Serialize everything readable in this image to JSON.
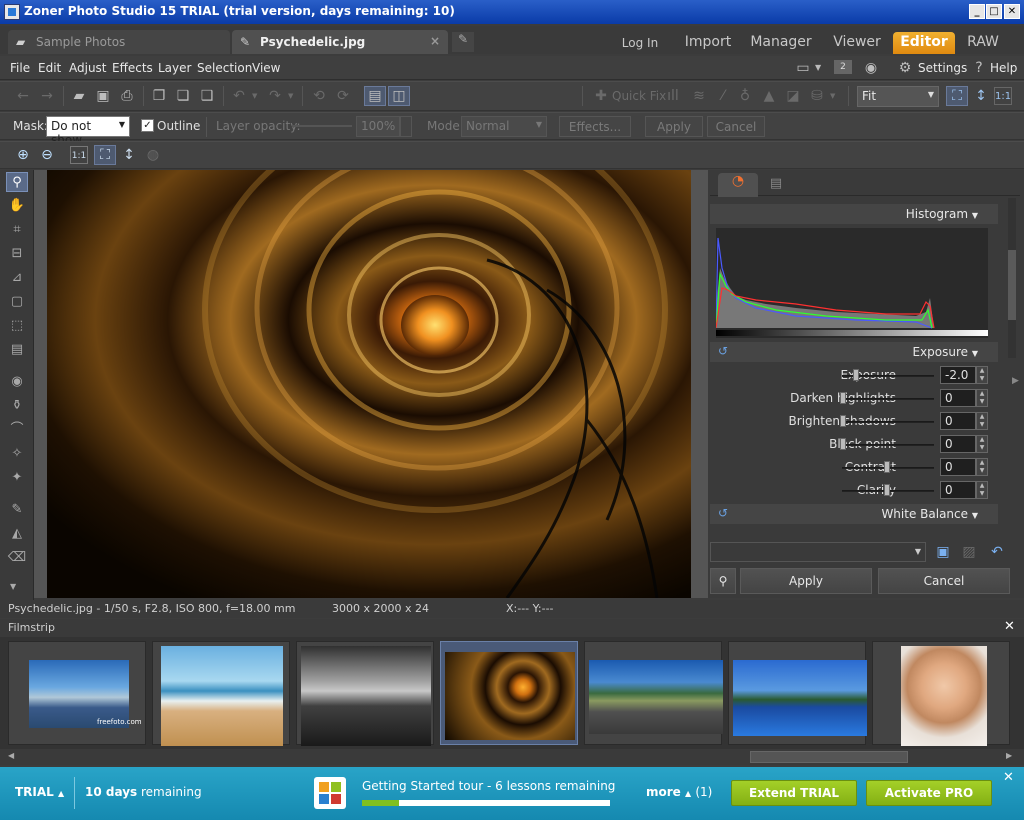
{
  "window": {
    "title": "Zoner Photo Studio 15 TRIAL (trial version, days remaining: 10)"
  },
  "tabs": {
    "doc_tabs": [
      {
        "label": "Sample Photos"
      },
      {
        "label": "Psychedelic.jpg"
      }
    ],
    "login": "Log In",
    "modes": [
      "Import",
      "Manager",
      "Viewer",
      "Editor",
      "RAW"
    ],
    "active_mode": "Editor"
  },
  "menu": {
    "items": [
      "File",
      "Edit",
      "Adjust",
      "Effects",
      "Layer",
      "Selection",
      "View"
    ],
    "right": {
      "settings": "Settings",
      "help": "Help",
      "badge": "2"
    }
  },
  "toolbar": {
    "quick_fix": "Quick Fix",
    "zoom_mode": "Fit"
  },
  "maskbar": {
    "mask_label": "Mask:",
    "mask_value": "Do not show",
    "outline_label": "Outline",
    "outline_checked": true,
    "layer_opacity_label": "Layer opacity:",
    "layer_opacity_value": "100%",
    "mode_label": "Mode:",
    "mode_value": "Normal",
    "effects_label": "Effects...",
    "apply_label": "Apply",
    "cancel_label": "Cancel"
  },
  "panel": {
    "histogram_title": "Histogram",
    "exposure_title": "Exposure",
    "controls": [
      {
        "label": "Exposure",
        "value": "-2.0",
        "position": 0.15
      },
      {
        "label": "Darken highlights",
        "value": "0",
        "position": 0.0
      },
      {
        "label": "Brighten shadows",
        "value": "0",
        "position": 0.0
      },
      {
        "label": "Black point",
        "value": "0",
        "position": 0.0
      },
      {
        "label": "Contrast",
        "value": "0",
        "position": 0.5
      },
      {
        "label": "Clarity",
        "value": "0",
        "position": 0.5
      }
    ],
    "white_balance_title": "White Balance",
    "apply_label": "Apply",
    "cancel_label": "Cancel"
  },
  "status": {
    "file_info": "Psychedelic.jpg - 1/50 s, F2.8, ISO 800, f=18.00 mm",
    "dimensions": "3000 x 2000 x 24",
    "coords": "X:---  Y:---"
  },
  "filmstrip": {
    "title": "Filmstrip",
    "thumbnails": [
      {
        "subject": "city skyline",
        "caption": "freefoto.com"
      },
      {
        "subject": "beach couple",
        "caption": ""
      },
      {
        "subject": "dark seascape",
        "caption": ""
      },
      {
        "subject": "spiral staircase",
        "caption": ""
      },
      {
        "subject": "mountain road",
        "caption": ""
      },
      {
        "subject": "lake reflection",
        "caption": ""
      },
      {
        "subject": "smiling woman",
        "caption": ""
      }
    ],
    "selected_index": 3
  },
  "trial": {
    "label": "TRIAL",
    "days_bold": "10 days",
    "days_rest": "remaining",
    "tour_text": "Getting Started tour - 6 lessons remaining",
    "tour_progress": 0.15,
    "more_label": "more",
    "more_count": "(1)",
    "extend_label": "Extend TRIAL",
    "activate_label": "Activate PRO"
  },
  "colors": {
    "accent_orange": "#e8961c",
    "trial_blue": "#1d9ac0",
    "green_button": "#94c01e"
  }
}
